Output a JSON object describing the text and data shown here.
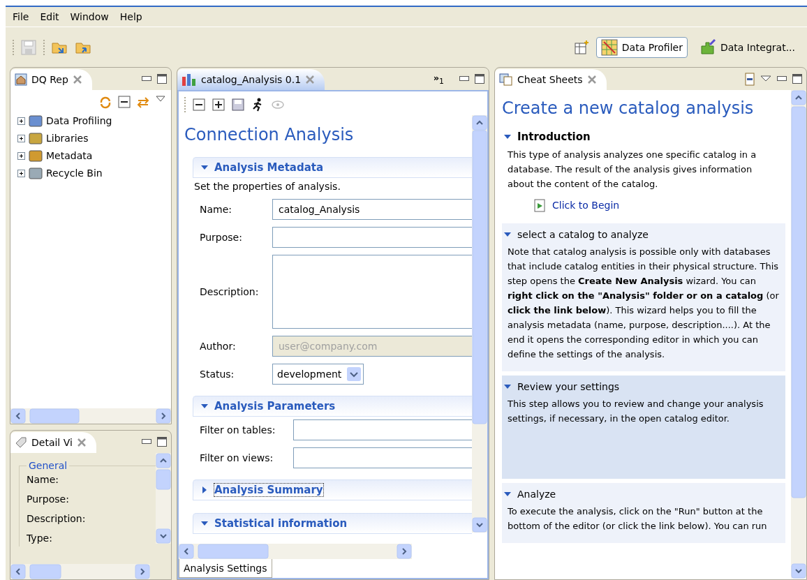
{
  "menu": [
    "File",
    "Edit",
    "Window",
    "Help"
  ],
  "perspectives": [
    {
      "label": "Data Profiler",
      "selected": true
    },
    {
      "label": "Data Integrat...",
      "selected": false
    }
  ],
  "repository": {
    "tab": "DQ Rep",
    "items": [
      {
        "label": "Data Profiling",
        "expanded": false
      },
      {
        "label": "Libraries",
        "expanded": false
      },
      {
        "label": "Metadata",
        "expanded": false
      },
      {
        "label": "Recycle Bin",
        "expanded": false
      }
    ]
  },
  "detail": {
    "tab": "Detail Vi",
    "group": "General",
    "fields": [
      "Name:",
      "Purpose:",
      "Description:",
      "Type:"
    ]
  },
  "editor": {
    "tab": "catalog_Analysis 0.1",
    "overflow_marker": "»",
    "overflow_count": "1",
    "title": "Connection Analysis",
    "sections": [
      {
        "title": "Analysis Metadata",
        "expanded": true,
        "focused": false,
        "description": "Set the properties of analysis.",
        "fields": [
          {
            "label": "Name:",
            "kind": "text",
            "value": "catalog_Analysis",
            "disabled": false
          },
          {
            "label": "Purpose:",
            "kind": "text",
            "disabled": false
          },
          {
            "label": "Description:",
            "kind": "textarea",
            "disabled": false
          },
          {
            "label": "Author:",
            "kind": "text",
            "value": "user@company.com",
            "disabled": true
          },
          {
            "label": "Status:",
            "kind": "select",
            "value": "development",
            "disabled": false
          }
        ]
      },
      {
        "title": "Analysis Parameters",
        "expanded": true,
        "focused": false,
        "fields": [
          {
            "label": "Filter on tables:",
            "kind": "text",
            "disabled": false
          },
          {
            "label": "Filter on views:",
            "kind": "text",
            "disabled": false
          }
        ]
      },
      {
        "title": "Analysis Summary",
        "expanded": false,
        "focused": true
      },
      {
        "title": "Statistical information",
        "expanded": true,
        "focused": false
      }
    ],
    "bottom_tab": "Analysis Settings"
  },
  "cheat_sheet": {
    "tab": "Cheat Sheets",
    "title": "Create a new catalog analysis",
    "intro": {
      "title": "Introduction",
      "expanded": true,
      "text": "This type of analysis analyzes one specific catalog in a database. The result of the analysis gives information about the content of the catalog.",
      "link": "Click to Begin"
    },
    "steps": [
      {
        "title": "select a catalog to analyze",
        "expanded": true,
        "selected": false,
        "text": "Note that catalog analysis is possible only with databases that include catalog entities in their physical structure. This step opens the **Create New Analysis** wizard. You can **right click on the \"Analysis\" folder or on a catalog** (or **click the link below**). This wizard helps you to fill the analysis metadata (name, purpose, description....). At the end it opens the corresponding editor in which you can define the settings of the analysis."
      },
      {
        "title": "Review your settings",
        "expanded": true,
        "selected": true,
        "text": "This step allows you to review and change your analysis settings, if necessary, in the open catalog editor."
      },
      {
        "title": "Analyze",
        "expanded": true,
        "selected": false,
        "text": "To execute the analysis, click on the \"Run\" button at the bottom of the editor (or click the link below). You can run"
      }
    ]
  }
}
